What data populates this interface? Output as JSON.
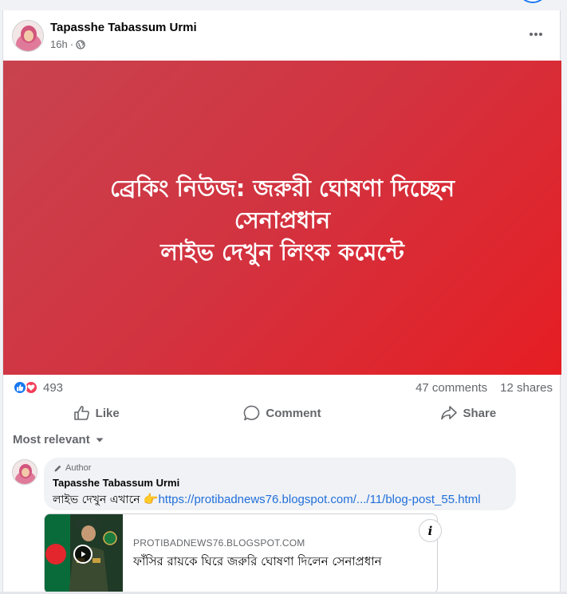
{
  "post": {
    "author": "Tapasshe Tabassum Urmi",
    "time": "16h",
    "audience_icon": "globe-icon",
    "banner": {
      "line1": "ব্রেকিং নিউজ: জরুরী ঘোষণা দিচ্ছেন",
      "line2": "সেনাপ্রধান",
      "line3": "লাইভ দেখুন লিংক কমেন্টে",
      "gradient_from": "#c8434f",
      "gradient_to": "#e61e23"
    }
  },
  "stats": {
    "reaction_count": "493",
    "comments": "47 comments",
    "shares": "12 shares"
  },
  "actions": {
    "like": "Like",
    "comment": "Comment",
    "share": "Share"
  },
  "sort": {
    "label": "Most relevant"
  },
  "comment": {
    "author_tag": "Author",
    "name": "Tapasshe Tabassum Urmi",
    "text": "লাইভ দেখুন এখানে",
    "emoji": "👉",
    "link": "https://protibadnews76.blogspot.com/.../11/blog-post_55.html"
  },
  "link_card": {
    "domain": "PROTIBADNEWS76.BLOGSPOT.COM",
    "headline": "ফাঁসির রায়কে ঘিরে জরুরি ঘোষণা দিলেন সেনাপ্রধান"
  },
  "colors": {
    "accent": "#1877f2",
    "link": "#216fdb",
    "love": "#f33e58",
    "muted_text": "#65676b"
  }
}
